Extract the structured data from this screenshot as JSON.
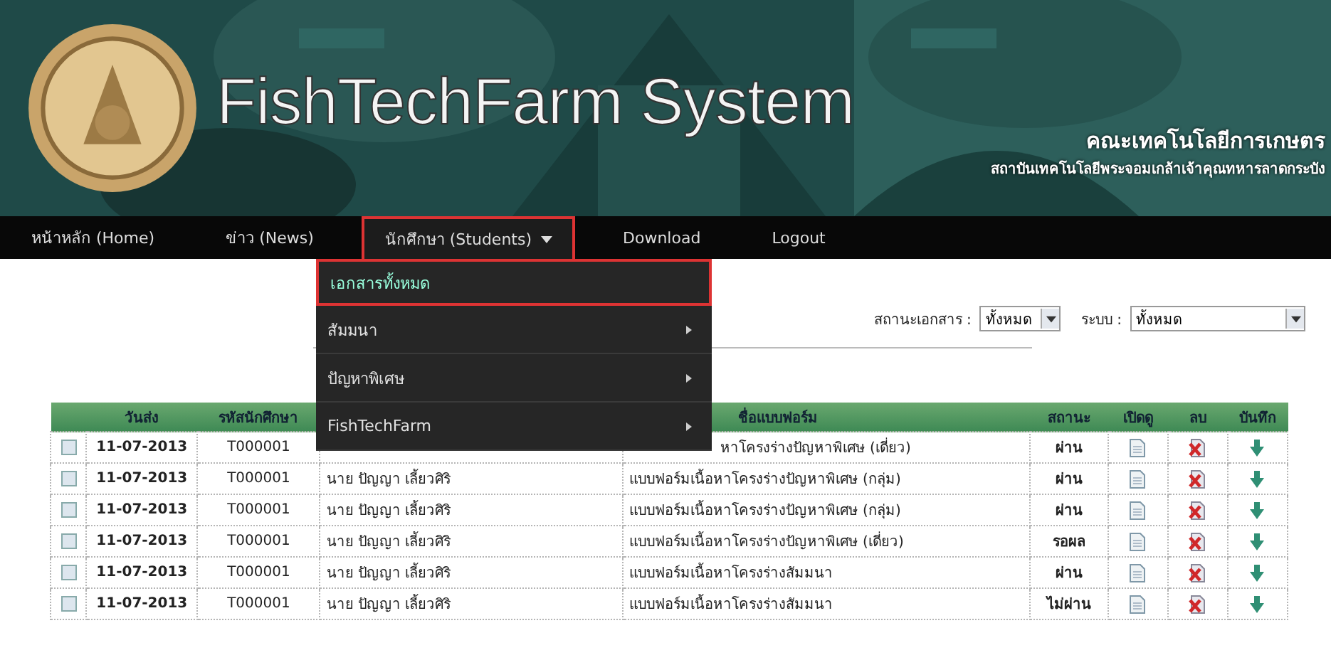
{
  "header": {
    "title": "FishTechFarm System",
    "faculty": "คณะเทคโนโลยีการเกษตร",
    "institute": "สถาบันเทคโนโลยีพระจอมเกล้าเจ้าคุณทหารลาดกระบัง"
  },
  "nav": [
    {
      "label": "หน้าหลัก (Home)",
      "selected": false,
      "dropdown": false
    },
    {
      "label": "ข่าว (News)",
      "selected": false,
      "dropdown": false
    },
    {
      "label": "นักศึกษา (Students)",
      "selected": true,
      "dropdown": true
    },
    {
      "label": "Download",
      "selected": false,
      "dropdown": false
    },
    {
      "label": "Logout",
      "selected": false,
      "dropdown": false
    }
  ],
  "menu": [
    {
      "label": "เอกสารทั้งหมด",
      "kind": "link",
      "selected": true
    },
    {
      "label": "สัมมนา",
      "kind": "submenu",
      "selected": false
    },
    {
      "label": "ปัญหาพิเศษ",
      "kind": "submenu",
      "selected": false
    },
    {
      "label": "FishTechFarm",
      "kind": "submenu",
      "selected": false
    }
  ],
  "filters": [
    {
      "label": "สถานะเอกสาร :",
      "value": "ทั้งหมด"
    },
    {
      "label": "ระบบ :",
      "value": "ทั้งหมด"
    }
  ],
  "table": {
    "columns": [
      "วันส่ง",
      "รหัสนักศึกษา",
      "ชื่อแบบฟอร์ม",
      "สถานะ",
      "เปิดดู",
      "ลบ",
      "บันทึก"
    ],
    "rows": [
      {
        "checked": false,
        "date": "11-07-2013",
        "id": "T000001",
        "form": "หาโครงร่างปัญหาพิเศษ (เดี่ยว)",
        "status": "ผ่าน"
      },
      {
        "checked": false,
        "date": "11-07-2013",
        "id": "T000001",
        "name": "นาย ปัญญา เลี้ยวศิริ",
        "form": "แบบฟอร์มเนื้อหาโครงร่างปัญหาพิเศษ (กลุ่ม)",
        "status": "ผ่าน"
      },
      {
        "checked": false,
        "date": "11-07-2013",
        "id": "T000001",
        "name": "นาย ปัญญา เลี้ยวศิริ",
        "form": "แบบฟอร์มเนื้อหาโครงร่างปัญหาพิเศษ (กลุ่ม)",
        "status": "ผ่าน"
      },
      {
        "checked": false,
        "date": "11-07-2013",
        "id": "T000001",
        "name": "นาย ปัญญา เลี้ยวศิริ",
        "form": "แบบฟอร์มเนื้อหาโครงร่างปัญหาพิเศษ (เดี่ยว)",
        "status": "รอผล"
      },
      {
        "checked": false,
        "date": "11-07-2013",
        "id": "T000001",
        "name": "นาย ปัญญา เลี้ยวศิริ",
        "form": "แบบฟอร์มเนื้อหาโครงร่างสัมมนา",
        "status": "ผ่าน"
      },
      {
        "checked": false,
        "date": "11-07-2013",
        "id": "T000001",
        "name": "นาย ปัญญา เลี้ยวศิริ",
        "form": "แบบฟอร์มเนื้อหาโครงร่างสัมมนา",
        "status": "ไม่ผ่าน"
      }
    ]
  }
}
